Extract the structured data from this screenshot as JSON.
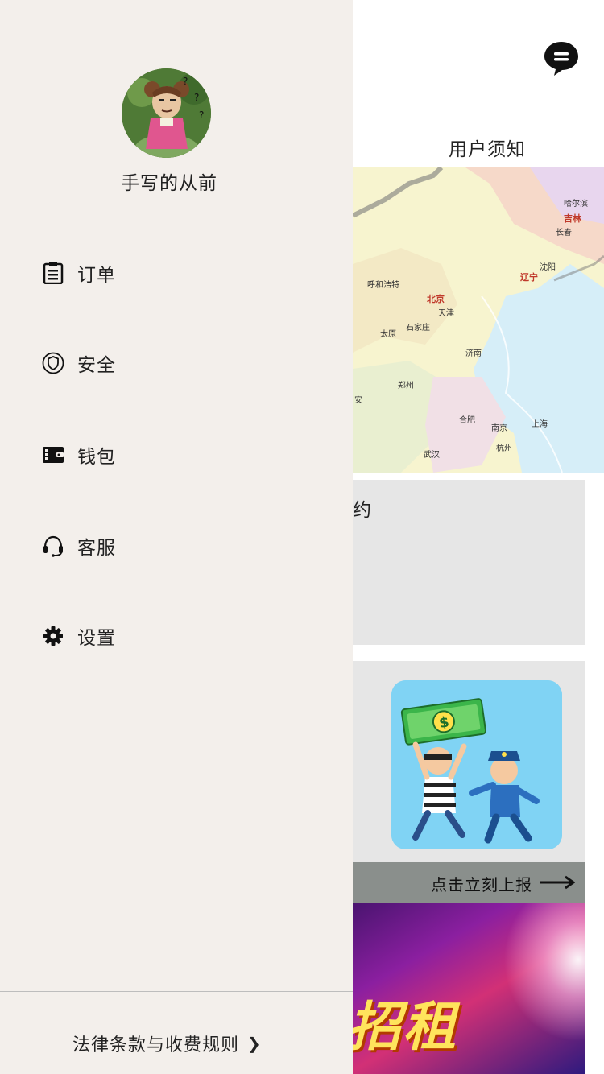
{
  "header": {
    "message_icon": "message-bubble-icon",
    "notice_tab_label": "用户须知"
  },
  "map_card": {
    "labels": [
      "吉林",
      "长春",
      "哈尔滨",
      "沈阳",
      "辽宁",
      "呼和浩特",
      "北京",
      "天津",
      "石家庄",
      "太原",
      "济南",
      "郑州",
      "合肥",
      "南京",
      "上海",
      "杭州",
      "武汉",
      "安"
    ]
  },
  "gray_card": {
    "title_fragment": "约"
  },
  "report_card": {
    "action_label": "点击立刻上报",
    "arrow_icon": "right-arrow-icon"
  },
  "banner": {
    "text": "招租"
  },
  "drawer": {
    "username": "手写的从前",
    "avatar_icon": "avatar-image",
    "menu": [
      {
        "label": "订单",
        "icon": "clipboard-icon"
      },
      {
        "label": "安全",
        "icon": "shield-icon"
      },
      {
        "label": "钱包",
        "icon": "wallet-icon"
      },
      {
        "label": "客服",
        "icon": "headset-icon"
      },
      {
        "label": "设置",
        "icon": "gear-icon"
      }
    ],
    "legal_label": "法律条款与收费规则",
    "legal_chevron": "❯"
  },
  "colors": {
    "drawer_bg": "#f3efeb",
    "card_gray": "#e6e6e6",
    "report_bar": "#8a8f8c"
  }
}
